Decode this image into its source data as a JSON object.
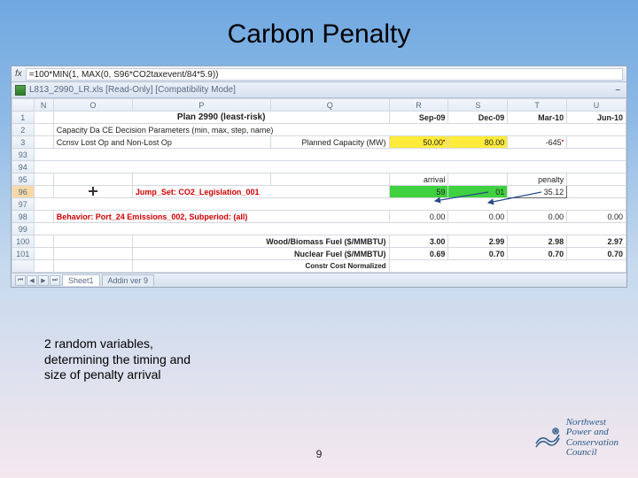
{
  "slide": {
    "title": "Carbon Penalty",
    "caption": "2 random variables, determining the timing and size of penalty arrival",
    "page_number": "9"
  },
  "excel": {
    "formula_label": "fx",
    "formula": "=100*MIN(1, MAX(0, S96*CO2taxevent/84*5.9))",
    "workbook_name": "L813_2990_LR.xls  [Read-Only]  [Compatibility Mode]",
    "columns": [
      "",
      "N",
      "O",
      "P",
      "Q",
      "R",
      "S",
      "T",
      "U"
    ],
    "rows": {
      "r1": {
        "num": "1",
        "plan": "Plan 2990 (least-risk)",
        "R": "Sep-09",
        "S": "Dec-09",
        "T": "Mar-10",
        "U": "Jun-10"
      },
      "r2": {
        "num": "2",
        "text": "Capacity Da CE Decision Parameters (min, max, step, name)"
      },
      "r3": {
        "num": "3",
        "text_a": "Ccnsv Lost Op and Non-Lost Op",
        "text_b": "Planned Capacity (MW)",
        "R": "50.00",
        "S": "80.00",
        "T": "-645"
      },
      "r93": {
        "num": "93"
      },
      "r94": {
        "num": "94"
      },
      "r95": {
        "num": "95",
        "arrival": "arrival",
        "penalty": "penalty"
      },
      "r96": {
        "num": "96",
        "jump": "Jump_Set: CO2_Legislation_001",
        "R": "59",
        "S": "01",
        "T": "35.12"
      },
      "r97": {
        "num": "97"
      },
      "r98": {
        "num": "98",
        "behavior": "Behavior: Port_24 Emissions_002, Subperiod: (all)",
        "R": "0.00",
        "S": "0.00",
        "T": "0.00",
        "U": "0.00"
      },
      "r99": {
        "num": "99"
      },
      "r100": {
        "num": "100",
        "label": "Wood/Biomass Fuel ($/MMBTU)",
        "R": "3.00",
        "S": "2.99",
        "T": "2.98",
        "U": "2.97"
      },
      "r101": {
        "num": "101",
        "label": "Nuclear Fuel ($/MMBTU)",
        "R": "0.69",
        "S": "0.70",
        "T": "0.70",
        "U": "0.70"
      },
      "r102": {
        "label": "Constr Cost Normalized"
      }
    },
    "tabs": {
      "sheet1": "Sheet1",
      "addin": "Addin ver 9"
    }
  },
  "logo": {
    "line1": "Northwest",
    "line2": "Power and",
    "line3": "Conservation",
    "line4": "Council"
  }
}
